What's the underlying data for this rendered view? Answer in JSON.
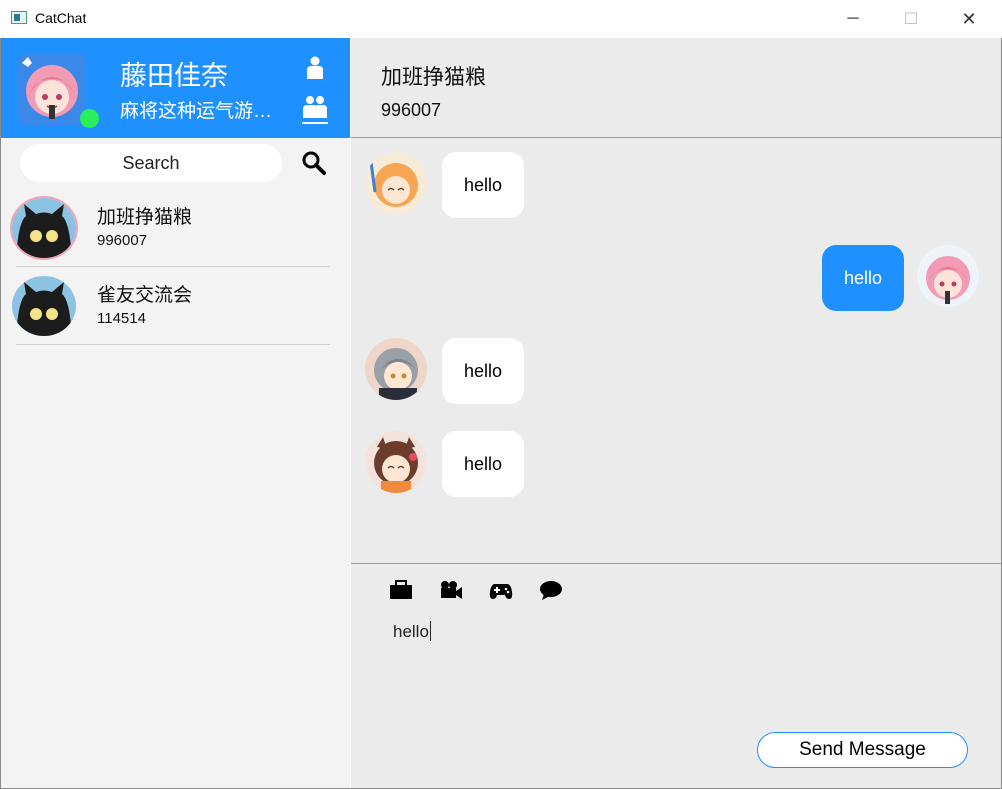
{
  "window": {
    "title": "CatChat",
    "minimize_glyph": "─",
    "maximize_glyph": "☐",
    "close_glyph": "✕"
  },
  "profile": {
    "name": "藤田佳奈",
    "signature": "麻将这种运气游…",
    "status_color": "#29f05a",
    "tabs": [
      "person-icon",
      "group-icon"
    ]
  },
  "search": {
    "placeholder": "Search",
    "icon": "search-icon"
  },
  "contacts": [
    {
      "name": "加班挣猫粮",
      "id": "996007"
    },
    {
      "name": "雀友交流会",
      "id": "114514"
    }
  ],
  "chat": {
    "title": "加班挣猫粮",
    "id": "996007",
    "messages": [
      {
        "direction": "in",
        "text": "hello"
      },
      {
        "direction": "out",
        "text": "hello"
      },
      {
        "direction": "in",
        "text": "hello"
      },
      {
        "direction": "in",
        "text": "hello"
      }
    ],
    "tools": [
      "folder-icon",
      "video-camera-icon",
      "gamepad-icon",
      "chat-bubble-icon"
    ],
    "input_value": "hello",
    "send_label": "Send Message"
  },
  "colors": {
    "accent": "#1e90ff",
    "sidebar_bg": "#f3f3f3",
    "chat_bg": "#ebebeb"
  }
}
